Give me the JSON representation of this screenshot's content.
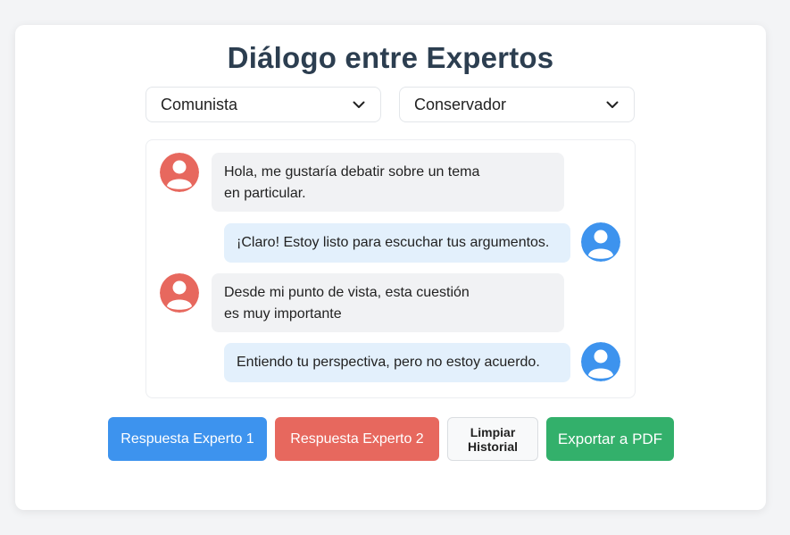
{
  "title": "Diálogo entre Expertos",
  "selectors": {
    "left": {
      "value": "Comunista"
    },
    "right": {
      "value": "Conservador"
    }
  },
  "messages": [
    {
      "side": "left",
      "text": "Hola, me gustaría debatir sobre un tema\nen particular."
    },
    {
      "side": "right",
      "text": "¡Claro! Estoy listo para escuchar tus argumentos."
    },
    {
      "side": "left",
      "text": "Desde mi punto de vista, esta cuestión\nes muy importante"
    },
    {
      "side": "right",
      "text": "Entiendo tu perspectiva, pero no estoy acuerdo."
    }
  ],
  "buttons": {
    "expert1": "Respuesta Experto 1",
    "expert2": "Respuesta Experto 2",
    "clear": "Limpiar\nHistorial",
    "export": "Exportar a PDF"
  },
  "colors": {
    "expert1_avatar": "#3d93ee",
    "expert2_avatar": "#e7685e",
    "green": "#33b06b"
  }
}
